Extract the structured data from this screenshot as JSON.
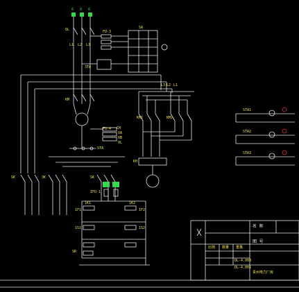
{
  "colors": {
    "background": "#000000",
    "wire": "#e8e8e8",
    "label_yellow": "#f2e64a",
    "label_green": "#39d64a",
    "label_cyan": "#3fe0e0",
    "red": "#e03030"
  },
  "power": {
    "phase_labels": [
      "8",
      "8",
      "8"
    ],
    "qs_label": "QL",
    "fu3_label": "FU-3",
    "sa_label": "SA",
    "sta_label": "3TA",
    "l_labels": [
      "L1",
      "L2",
      "L3"
    ]
  },
  "left_section": {
    "km_label": "KM",
    "l_right_labels": [
      "L3",
      "L2",
      "L1"
    ],
    "fu4_label": "FU-4",
    "ch_labels": [
      "CH",
      "VA",
      "VB",
      "VL"
    ],
    "sta2_label": "STA",
    "sk_labels": [
      "SK",
      "3K",
      "SK"
    ],
    "ifu_label": "IFU-1"
  },
  "right_section": {
    "km1_label": "KM1",
    "km2_label": "KM2",
    "kh_label": "KH"
  },
  "contacts": {
    "k_labels": [
      "1K1",
      "1K2",
      "1F1",
      "1F2",
      "1S1",
      "1S2"
    ],
    "sr_label": "SR"
  },
  "mini_panels": [
    {
      "label": "STA1"
    },
    {
      "label": "STA2"
    },
    {
      "label": "STA3"
    }
  ],
  "title_block": {
    "name_label": "名 称",
    "drawing_label": "图 号",
    "company_label": "贵州电力厂房",
    "scale_labels": [
      "比例",
      "数量",
      "重量"
    ],
    "code_labels": [
      "DL-4.000",
      "DL-4.001"
    ]
  }
}
